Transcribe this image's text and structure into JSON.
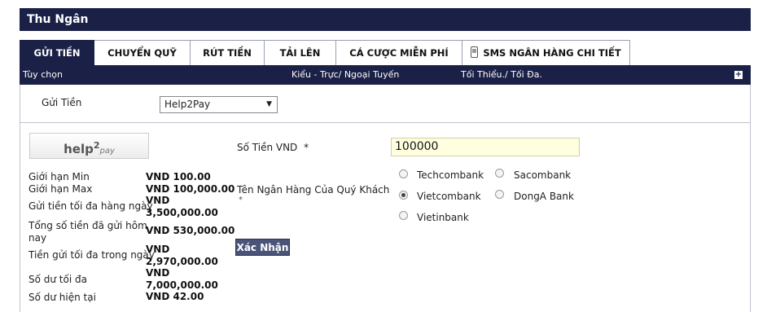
{
  "header": {
    "title": "Thu Ngân"
  },
  "tabs": [
    {
      "label": "GỬI TIỀN",
      "active": true
    },
    {
      "label": "CHUYỂN QUỸ",
      "active": false
    },
    {
      "label": "RÚT TIỀN",
      "active": false
    },
    {
      "label": "TẢI LÊN",
      "active": false
    },
    {
      "label": "CÁ CƯỢC MIỄN PHÍ",
      "active": false
    },
    {
      "label": "SMS NGÂN HÀNG CHI TIẾT",
      "active": false,
      "icon": "phone-icon"
    }
  ],
  "columns": {
    "option": "Tùy chọn",
    "type": "Kiểu - Trực/ Ngoại Tuyến",
    "minmax": "Tối Thiểu./ Tối Đa."
  },
  "deposit": {
    "label": "Gửi Tiền",
    "method_selected": "Help2Pay"
  },
  "logo": {
    "part1": "help",
    "part2": "2",
    "part3": "pay"
  },
  "limits": [
    {
      "label": "Giới hạn Min",
      "value": "VND 100.00"
    },
    {
      "label": "Giới hạn Max",
      "value": "VND 100,000.00"
    },
    {
      "label": "Gửi tiền tối đa hàng ngày",
      "value_line1": "VND",
      "value_line2": "3,500,000.00"
    },
    {
      "label_line1": "Tổng số tiền đã gửi hôm",
      "label_line2": "nay",
      "value": "VND 530,000.00"
    },
    {
      "label": "Tiền gửi tối đa trong ngày",
      "value_line1": "VND",
      "value_line2": "2,970,000.00"
    },
    {
      "label": "Số dư tối đa",
      "value_line1": "VND",
      "value_line2": "7,000,000.00"
    },
    {
      "label": "Số dư hiện tại",
      "value": "VND 42.00"
    }
  ],
  "form": {
    "amount_label": "Số Tiền VND",
    "required_mark": "*",
    "amount_value": "100000",
    "bank_label": "Tên Ngân Hàng Của Quý Khách",
    "banks": [
      {
        "name": "Techcombank",
        "selected": false
      },
      {
        "name": "Sacombank",
        "selected": false
      },
      {
        "name": "Vietcombank",
        "selected": true
      },
      {
        "name": "DongA Bank",
        "selected": false
      },
      {
        "name": "Vietinbank",
        "selected": false
      }
    ],
    "submit_label": "Xác Nhận"
  }
}
